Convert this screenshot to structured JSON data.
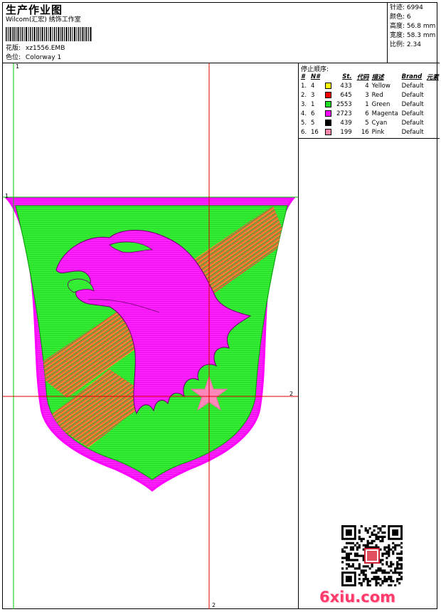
{
  "header": {
    "title": "生产作业图",
    "company": "Wilcom(汇宏) 绣饰工作室",
    "design_label": "花版:",
    "design_name": "xz1556.EMB",
    "colorway_label": "色位:",
    "colorway_name": "Colorway 1"
  },
  "stats": [
    {
      "label": "针迹:",
      "value": "6994"
    },
    {
      "label": "颜色:",
      "value": "6"
    },
    {
      "label": "高度:",
      "value": "56.8 mm"
    },
    {
      "label": "宽度:",
      "value": "58.3 mm"
    },
    {
      "label": "比例:",
      "value": "2.34"
    }
  ],
  "stop_sequence": {
    "title": "停止顺序:",
    "columns": [
      "#",
      "N#",
      "St.",
      "代码",
      "描述",
      "Brand",
      "元素"
    ],
    "rows": [
      {
        "idx": "1.",
        "n": "4",
        "swatch": "#ffff00",
        "st": "433",
        "code": "4",
        "desc": "Yellow",
        "brand": "Default"
      },
      {
        "idx": "2.",
        "n": "3",
        "swatch": "#ff0000",
        "st": "645",
        "code": "3",
        "desc": "Red",
        "brand": "Default"
      },
      {
        "idx": "3.",
        "n": "1",
        "swatch": "#22dd22",
        "st": "2553",
        "code": "1",
        "desc": "Green",
        "brand": "Default"
      },
      {
        "idx": "4.",
        "n": "6",
        "swatch": "#ff00ff",
        "st": "2723",
        "code": "6",
        "desc": "Magenta",
        "brand": "Default"
      },
      {
        "idx": "5.",
        "n": "5",
        "swatch": "#000000",
        "st": "439",
        "code": "5",
        "desc": "Cyan",
        "brand": "Default"
      },
      {
        "idx": "6.",
        "n": "16",
        "swatch": "#ff88aa",
        "st": "199",
        "code": "16",
        "desc": "Pink",
        "brand": "Default"
      }
    ]
  },
  "guides": {
    "h1_label": "1",
    "v1_label": "1",
    "h2_label": "2",
    "v2_label": "2"
  },
  "colors": {
    "green_fill": "#33ee33",
    "magenta": "#ff22ff",
    "red": "#ff2222",
    "pink_star": "#ff88bb",
    "guide_green": "#00cc00",
    "guide_red": "#dd0000"
  },
  "watermark": "6xiu.com"
}
